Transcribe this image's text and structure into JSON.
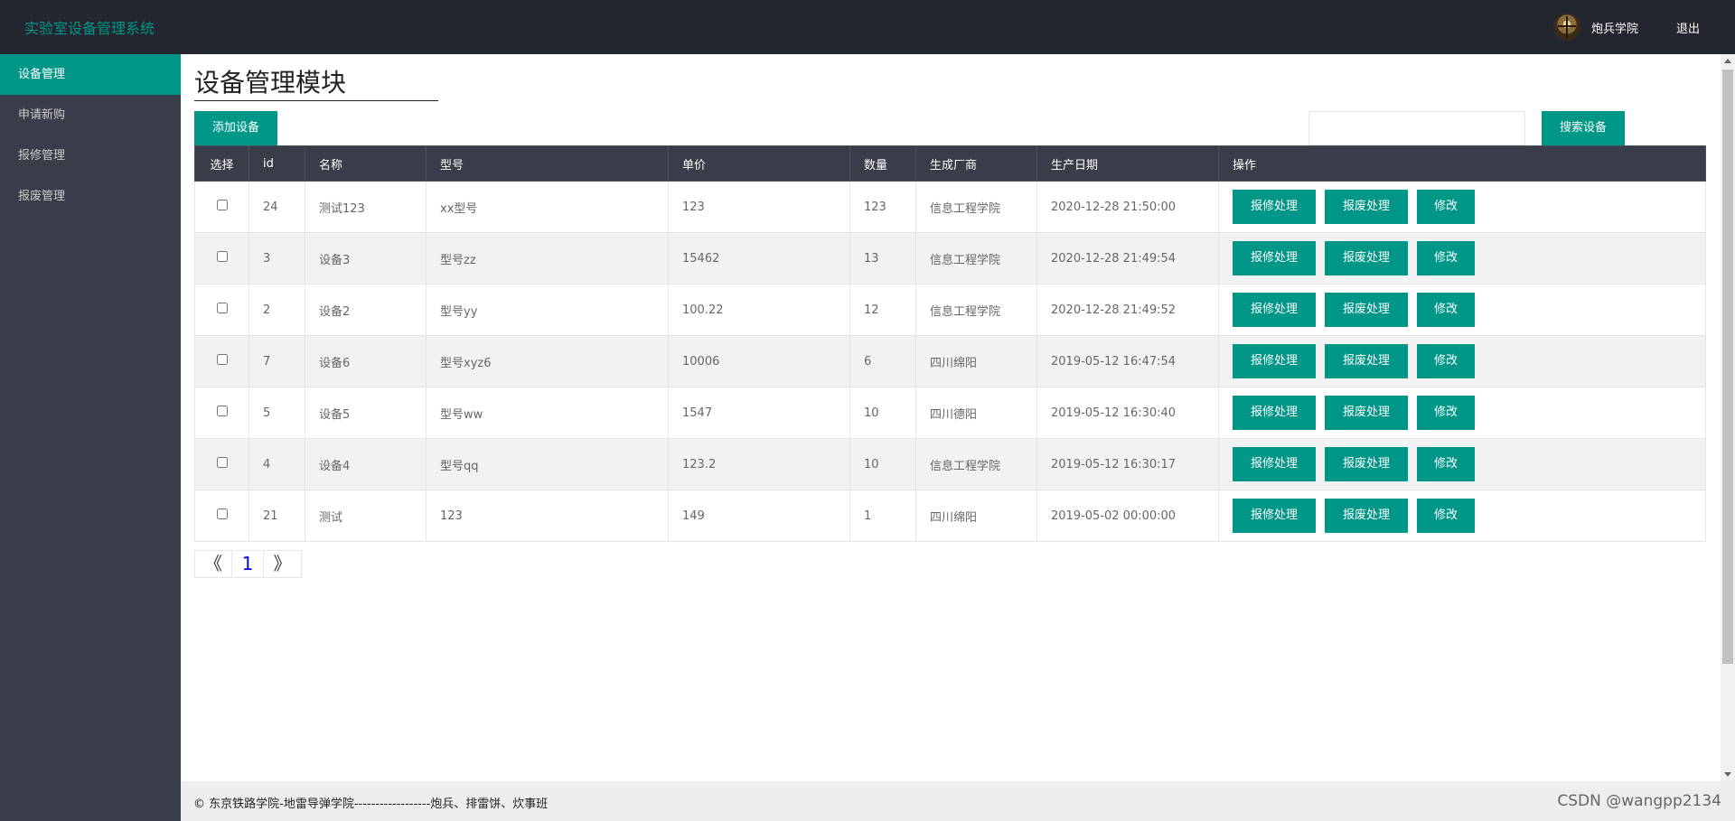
{
  "app": {
    "title": "实验室设备管理系统"
  },
  "user": {
    "name": "炮兵学院",
    "logout_label": "退出"
  },
  "sidebar": {
    "items": [
      {
        "label": "设备管理",
        "active": true
      },
      {
        "label": "申请新购",
        "active": false
      },
      {
        "label": "报修管理",
        "active": false
      },
      {
        "label": "报废管理",
        "active": false
      }
    ]
  },
  "main": {
    "title": "设备管理模块",
    "add_label": "添加设备",
    "search": {
      "placeholder": "",
      "value": "",
      "button_label": "搜索设备"
    }
  },
  "table": {
    "headers": [
      "选择",
      "id",
      "名称",
      "型号",
      "单价",
      "数量",
      "生成厂商",
      "生产日期",
      "操作"
    ],
    "op_labels": {
      "repair": "报修处理",
      "scrap": "报废处理",
      "edit": "修改"
    },
    "rows": [
      {
        "id": "24",
        "name": "测试123",
        "model": "xx型号",
        "price": "123",
        "qty": "123",
        "maker": "信息工程学院",
        "date": "2020-12-28 21:50:00"
      },
      {
        "id": "3",
        "name": "设备3",
        "model": "型号zz",
        "price": "15462",
        "qty": "13",
        "maker": "信息工程学院",
        "date": "2020-12-28 21:49:54"
      },
      {
        "id": "2",
        "name": "设备2",
        "model": "型号yy",
        "price": "100.22",
        "qty": "12",
        "maker": "信息工程学院",
        "date": "2020-12-28 21:49:52"
      },
      {
        "id": "7",
        "name": "设备6",
        "model": "型号xyz6",
        "price": "10006",
        "qty": "6",
        "maker": "四川绵阳",
        "date": "2019-05-12 16:47:54"
      },
      {
        "id": "5",
        "name": "设备5",
        "model": "型号ww",
        "price": "1547",
        "qty": "10",
        "maker": "四川德阳",
        "date": "2019-05-12 16:30:40"
      },
      {
        "id": "4",
        "name": "设备4",
        "model": "型号qq",
        "price": "123.2",
        "qty": "10",
        "maker": "信息工程学院",
        "date": "2019-05-12 16:30:17"
      },
      {
        "id": "21",
        "name": "测试",
        "model": "123",
        "price": "149",
        "qty": "1",
        "maker": "四川绵阳",
        "date": "2019-05-02 00:00:00"
      }
    ]
  },
  "pager": {
    "prev": "《",
    "current": "1",
    "next": "》"
  },
  "footer": {
    "text": "© 东京铁路学院-地雷导弹学院------------------炮兵、排雷饼、炊事班",
    "watermark": "CSDN @wangpp2134"
  },
  "colors": {
    "accent": "#009688",
    "topbar": "#23262e",
    "sidebar": "#393d49",
    "table_header": "#393d49"
  }
}
